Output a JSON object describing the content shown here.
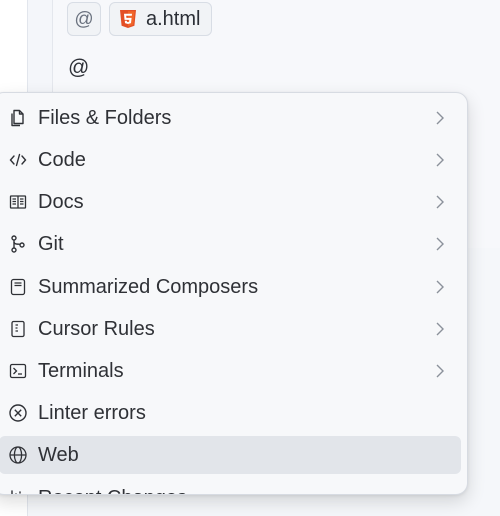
{
  "composer": {
    "context_at_symbol": "@",
    "file_chip_name": "a.html",
    "input_text": "@"
  },
  "menu": {
    "items": [
      {
        "label": "Files & Folders",
        "icon": "files-folders-icon",
        "has_submenu": true
      },
      {
        "label": "Code",
        "icon": "code-icon",
        "has_submenu": true
      },
      {
        "label": "Docs",
        "icon": "docs-icon",
        "has_submenu": true
      },
      {
        "label": "Git",
        "icon": "git-icon",
        "has_submenu": true
      },
      {
        "label": "Summarized Composers",
        "icon": "summarized-composers-icon",
        "has_submenu": true
      },
      {
        "label": "Cursor Rules",
        "icon": "cursor-rules-icon",
        "has_submenu": true
      },
      {
        "label": "Terminals",
        "icon": "terminal-icon",
        "has_submenu": true
      },
      {
        "label": "Linter errors",
        "icon": "linter-errors-icon",
        "has_submenu": false
      },
      {
        "label": "Web",
        "icon": "web-icon",
        "has_submenu": false,
        "highlighted": true
      },
      {
        "label": "Recent Changes",
        "icon": "recent-changes-icon",
        "has_submenu": false
      }
    ]
  },
  "colors": {
    "page_background": "#f4f6fa",
    "menu_background": "#f7f8fa",
    "highlight": "#e2e5ea",
    "html5_badge": "#e34f26",
    "text": "#2f3136",
    "muted": "#8b919b"
  }
}
